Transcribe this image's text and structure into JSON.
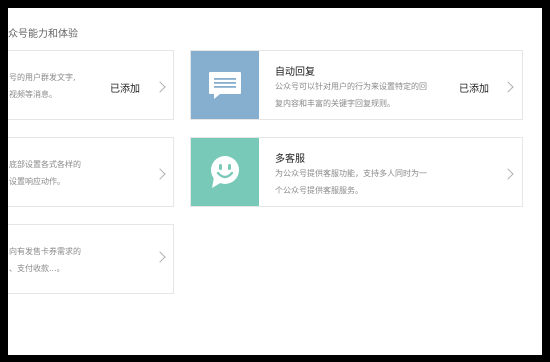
{
  "section": {
    "title": "众号能力和体验"
  },
  "colors": {
    "auto_reply_icon_bg": "#86afcf",
    "customer_service_icon_bg": "#79c9b8"
  },
  "left_cards": [
    {
      "desc_line1": "号的用户群发文字,",
      "desc_line2": "视频等消息。",
      "status": "已添加"
    },
    {
      "desc_line1": "底部设置各式各样的",
      "desc_line2": "设置响应动作。"
    },
    {
      "desc_line1": "向有发售卡券需求的",
      "desc_line2": "、支付收款...。"
    }
  ],
  "right_cards": [
    {
      "icon": "message-bubble-icon",
      "title": "自动回复",
      "desc_line1": "公众号可以针对用户的行为来设置特定的回",
      "desc_line2": "复内容和丰富的关键字回复规则。",
      "status": "已添加"
    },
    {
      "icon": "smiley-chat-icon",
      "title": "多客服",
      "desc_line1": "为公众号提供客服功能，支持多人同时为一",
      "desc_line2": "个公众号提供客服服务。"
    }
  ]
}
